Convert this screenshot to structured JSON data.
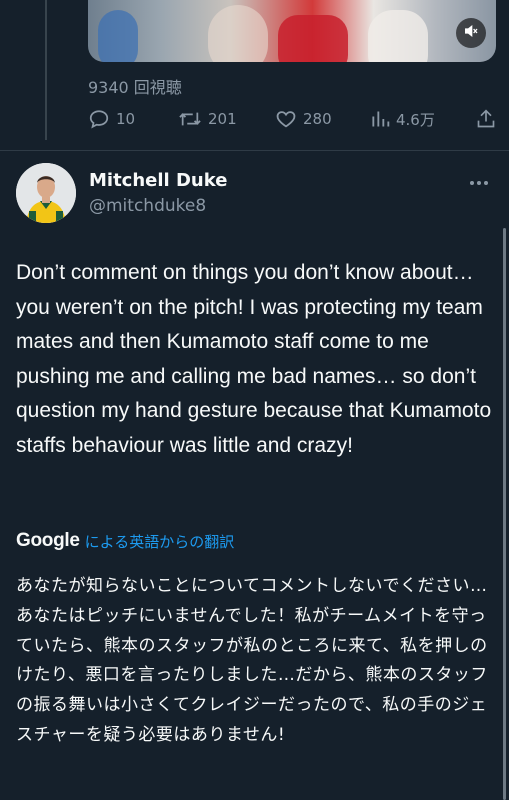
{
  "previous_tweet": {
    "views_text": "9340 回視聴",
    "reply_count": "10",
    "retweet_count": "201",
    "like_count": "280",
    "view_count": "4.6万"
  },
  "tweet": {
    "display_name": "Mitchell Duke",
    "handle": "@mitchduke8",
    "text": "Don’t comment on things you don’t know about… you weren’t on the pitch! I was protecting my team mates and then Kumamoto staff come to me pushing me and calling me bad names… so don’t question my hand gesture because that Kumamoto staffs behaviour was little and crazy!",
    "translation_brand": "Google",
    "translation_label": "による英語からの翻訳",
    "translated_text": "あなたが知らないことについてコメントしないでください…あなたはピッチにいませんでした！私がチームメイトを守っていたら、熊本のスタッフが私のところに来て、私を押しのけたり、悪口を言ったりしました…だから、熊本のスタッフの振る舞いは小さくてクレイジーだったので、私の手のジェスチャーを疑う必要はありません!"
  },
  "icons": {
    "mute": "speaker-muted-icon",
    "reply": "reply-icon",
    "retweet": "retweet-icon",
    "like": "heart-icon",
    "views": "bar-chart-icon",
    "share": "share-icon",
    "more": "more-dots-icon"
  },
  "colors": {
    "background": "#15202b",
    "text_primary": "#f7f9f9",
    "text_secondary": "#8b98a5",
    "link": "#1d9bf0"
  }
}
